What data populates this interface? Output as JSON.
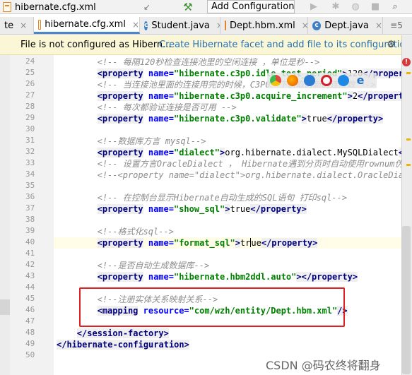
{
  "toolbar": {
    "file_name": "hibernate.cfg.xml",
    "config_button": "Add Configuration...",
    "icons": [
      "xml-file-icon",
      "arrow-icon",
      "hammer-icon",
      "run-icon",
      "debug-icon",
      "coverage-icon",
      "stop-icon",
      "search-icon"
    ]
  },
  "tabs": [
    {
      "label": "te",
      "icon": "none"
    },
    {
      "label": "hibernate.cfg.xml",
      "icon": "xml-file-icon",
      "active": true
    },
    {
      "label": "Student.java",
      "icon": "class-icon"
    },
    {
      "label": "Dept.hbm.xml",
      "icon": "xml-file-icon"
    },
    {
      "label": "Dept.java",
      "icon": "class-icon"
    }
  ],
  "tab_overflow": "≡5",
  "notification": {
    "text": "File is not configured as Hibern...",
    "link": "Create Hibernate facet and add file to its configuration"
  },
  "lines": [
    {
      "n": "24",
      "parts": [
        [
          "cm",
          "<!-- 每隔120秒检查连接池里的空闲连接 ，单位是秒-->"
        ]
      ]
    },
    {
      "n": "25",
      "parts": [
        [
          "tg",
          "<property"
        ],
        [
          "tx",
          " "
        ],
        [
          "at",
          "name="
        ],
        [
          "vl",
          "\"hibernate.c3p0.idle_test_period\""
        ],
        [
          "tg",
          ">"
        ],
        [
          "tx",
          "120"
        ],
        [
          "tg",
          "</property>"
        ]
      ]
    },
    {
      "n": "26",
      "parts": [
        [
          "cm",
          "<!-- 当连接池里面的连接用完的时候，C3P0一下获取的新的连接数 -->"
        ]
      ]
    },
    {
      "n": "27",
      "parts": [
        [
          "tg",
          "<property"
        ],
        [
          "tx",
          " "
        ],
        [
          "at",
          "name="
        ],
        [
          "vl",
          "\"hibernate.c3p0.acquire_increment\""
        ],
        [
          "tg",
          ">"
        ],
        [
          "tx",
          "2"
        ],
        [
          "tg",
          "</property>"
        ]
      ]
    },
    {
      "n": "28",
      "parts": [
        [
          "cm",
          "<!-- 每次都验证连接是否可用 -->"
        ]
      ]
    },
    {
      "n": "29",
      "parts": [
        [
          "tg",
          "<property"
        ],
        [
          "tx",
          " "
        ],
        [
          "at",
          "name="
        ],
        [
          "vl",
          "\"hibernate.c3p0.validate\""
        ],
        [
          "tg",
          ">"
        ],
        [
          "tx",
          "true"
        ],
        [
          "tg",
          "</property>"
        ]
      ]
    },
    {
      "n": "30",
      "parts": []
    },
    {
      "n": "31",
      "parts": [
        [
          "cm",
          "<!--数据库方言 mysql-->"
        ]
      ]
    },
    {
      "n": "32",
      "parts": [
        [
          "tg",
          "<property"
        ],
        [
          "tx",
          " "
        ],
        [
          "at",
          "name="
        ],
        [
          "vl",
          "\"dialect\""
        ],
        [
          "tg",
          ">"
        ],
        [
          "tx",
          "org.hibernate.dialect.MySQLDialect"
        ],
        [
          "tg",
          "</pr"
        ]
      ]
    },
    {
      "n": "33",
      "parts": [
        [
          "cm",
          "<!-- 设置方言OracleDialect ， Hibernate遇到分页时自动使用rownum伪列进"
        ]
      ]
    },
    {
      "n": "34",
      "parts": [
        [
          "cm",
          "<!--<property name=\"dialect\">org.hibernate.dialect.OracleDialect"
        ]
      ]
    },
    {
      "n": "35",
      "parts": []
    },
    {
      "n": "36",
      "parts": [
        [
          "cm",
          "<!-- 在控制台显示Hibernate自动生成的SQL语句 打印sql-->"
        ]
      ]
    },
    {
      "n": "37",
      "parts": [
        [
          "tg",
          "<property"
        ],
        [
          "tx",
          " "
        ],
        [
          "at",
          "name="
        ],
        [
          "vl",
          "\"show_sql\""
        ],
        [
          "tg",
          ">"
        ],
        [
          "tx",
          "true"
        ],
        [
          "tg",
          "</property>"
        ]
      ]
    },
    {
      "n": "38",
      "parts": []
    },
    {
      "n": "39",
      "parts": [
        [
          "cm",
          "<!--格式化sql-->"
        ]
      ]
    },
    {
      "n": "40",
      "parts": [
        [
          "tg",
          "<property"
        ],
        [
          "tx",
          " "
        ],
        [
          "at",
          "name="
        ],
        [
          "vl",
          "\"format_sql\""
        ],
        [
          "tg",
          ">"
        ],
        [
          "tx",
          "tr"
        ],
        [
          "cur",
          ""
        ],
        [
          "tx",
          "ue"
        ],
        [
          "tg",
          "</property>"
        ]
      ]
    },
    {
      "n": "41",
      "parts": []
    },
    {
      "n": "42",
      "parts": [
        [
          "cm",
          "<!--是否自动生成数据库-->"
        ]
      ]
    },
    {
      "n": "43",
      "parts": [
        [
          "tg",
          "<property"
        ],
        [
          "tx",
          " "
        ],
        [
          "at",
          "name="
        ],
        [
          "vl",
          "\"hibernate.hbm2ddl.auto\""
        ],
        [
          "tg",
          "></property>"
        ]
      ]
    },
    {
      "n": "44",
      "parts": []
    },
    {
      "n": "45",
      "parts": [
        [
          "cm",
          "<!--注册实体关系映射关系-->"
        ]
      ]
    },
    {
      "n": "46",
      "parts": [
        [
          "tg",
          "<mapping"
        ],
        [
          "tx",
          " "
        ],
        [
          "at",
          "resource="
        ],
        [
          "vl",
          "\"com/wzh/entity/Dept.hbm.xml\""
        ],
        [
          "tg",
          "/>"
        ]
      ]
    },
    {
      "n": "47",
      "parts": []
    },
    {
      "n": "48",
      "parts": [
        [
          "tg",
          "</session-factory>"
        ]
      ]
    },
    {
      "n": "49",
      "parts": [
        [
          "tg",
          "</hibernate-configuration>"
        ]
      ]
    },
    {
      "n": "50",
      "parts": []
    }
  ],
  "indent": {
    "24": 4,
    "25": 4,
    "26": 4,
    "27": 4,
    "28": 4,
    "29": 4,
    "31": 4,
    "32": 4,
    "33": 4,
    "34": 4,
    "36": 4,
    "37": 4,
    "39": 4,
    "40": 4,
    "42": 4,
    "43": 4,
    "45": 4,
    "46": 4,
    "48": 2,
    "49": 0
  },
  "error_badge": "!",
  "watermark": "CSDN @码农终将翻身",
  "colors": {
    "accent": "#4a86c8",
    "highlight_box": "#e02020",
    "notify_bg": "#fbf6d5",
    "link": "#2470b3"
  }
}
